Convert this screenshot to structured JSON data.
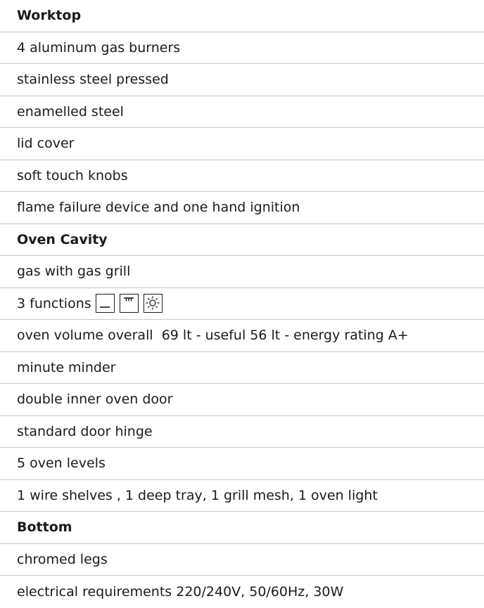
{
  "sections": [
    {
      "heading": "Worktop",
      "items": [
        "4 aluminum gas burners",
        "stainless steel pressed",
        "enamelled steel",
        "lid cover",
        "soft touch knobs",
        "flame failure device and one hand ignition"
      ]
    },
    {
      "heading": "Oven Cavity",
      "items": [
        "gas with gas grill",
        "3 functions",
        "oven volume overall  69 lt - useful 56 lt - energy rating A+",
        "minute minder",
        "double inner oven door",
        "standard door hinge",
        "5 oven levels",
        "1 wire shelves , 1 deep tray, 1 grill mesh, 1 oven light"
      ]
    },
    {
      "heading": "Bottom",
      "items": [
        "chromed legs",
        "electrical requirements 220/240V, 50/60Hz, 30W"
      ]
    }
  ],
  "function_icons": [
    "bottom-heat-icon",
    "grill-icon",
    "oven-light-icon"
  ]
}
